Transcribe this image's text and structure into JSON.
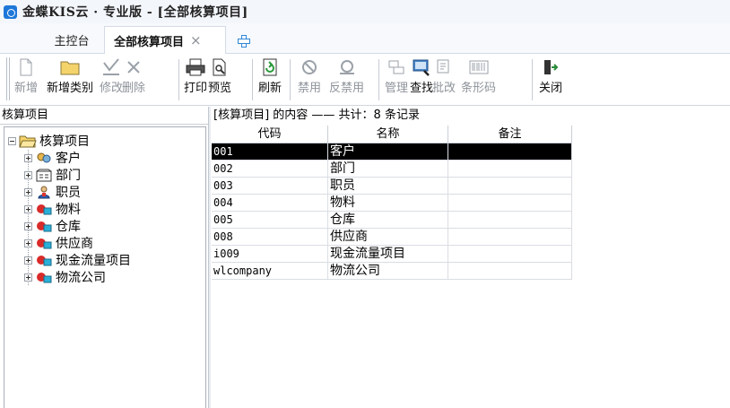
{
  "window": {
    "title": "金蝶KIS云 · 专业版 - [全部核算项目]"
  },
  "tabs": [
    {
      "label": "主控台"
    },
    {
      "label": "全部核算项目",
      "close": "×"
    }
  ],
  "toolbar": {
    "buttons": [
      {
        "label": "新增",
        "icon": "new-doc-icon",
        "enabled": false
      },
      {
        "label": "新增类别",
        "icon": "folder-icon",
        "enabled": true
      },
      {
        "label": "修改",
        "icon": "edit-icon",
        "enabled": false
      },
      {
        "label": "删除",
        "icon": "delete-icon",
        "enabled": false
      },
      {
        "label": "打印",
        "icon": "print-icon",
        "enabled": true
      },
      {
        "label": "预览",
        "icon": "preview-icon",
        "enabled": true
      },
      {
        "label": "刷新",
        "icon": "refresh-icon",
        "enabled": true
      },
      {
        "label": "禁用",
        "icon": "ban-icon",
        "enabled": false
      },
      {
        "label": "反禁用",
        "icon": "unban-icon",
        "enabled": false
      },
      {
        "label": "管理",
        "icon": "manage-icon",
        "enabled": false
      },
      {
        "label": "查找",
        "icon": "find-icon",
        "enabled": true
      },
      {
        "label": "批改",
        "icon": "batch-edit-icon",
        "enabled": false
      },
      {
        "label": "条形码",
        "icon": "barcode-icon",
        "enabled": false
      },
      {
        "label": "关闭",
        "icon": "exit-icon",
        "enabled": true
      }
    ]
  },
  "left_panel": {
    "header": "核算项目",
    "root": {
      "label": "核算项目",
      "expanded": true
    },
    "items": [
      {
        "label": "客户",
        "icon": "customer-icon"
      },
      {
        "label": "部门",
        "icon": "department-icon"
      },
      {
        "label": "职员",
        "icon": "employee-icon"
      },
      {
        "label": "物料",
        "icon": "item-icon"
      },
      {
        "label": "仓库",
        "icon": "item-icon"
      },
      {
        "label": "供应商",
        "icon": "item-icon"
      },
      {
        "label": "现金流量项目",
        "icon": "item-icon"
      },
      {
        "label": "物流公司",
        "icon": "item-icon"
      }
    ]
  },
  "right_panel": {
    "summary": "[核算项目] 的内容 —— 共计：8 条记录",
    "columns": [
      "代码",
      "名称",
      "备注"
    ],
    "rows": [
      {
        "code": "001",
        "name": "客户",
        "note": ""
      },
      {
        "code": "002",
        "name": "部门",
        "note": ""
      },
      {
        "code": "003",
        "name": "职员",
        "note": ""
      },
      {
        "code": "004",
        "name": "物料",
        "note": ""
      },
      {
        "code": "005",
        "name": "仓库",
        "note": ""
      },
      {
        "code": "008",
        "name": "供应商",
        "note": ""
      },
      {
        "code": "i009",
        "name": "现金流量项目",
        "note": ""
      },
      {
        "code": "wlcompany",
        "name": "物流公司",
        "note": ""
      }
    ],
    "selected_row": 0
  },
  "colors": {
    "accent": "#1e77d8",
    "selected_row_bg": "#000000",
    "disabled_text": "#8e939a"
  }
}
